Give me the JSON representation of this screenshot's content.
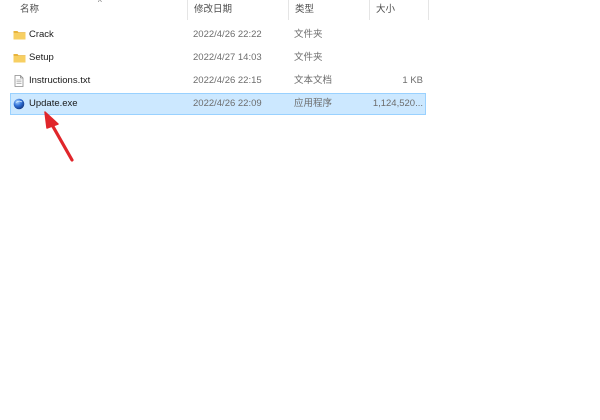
{
  "columns": {
    "name": "名称",
    "date": "修改日期",
    "type": "类型",
    "size": "大小",
    "sort_indicator": "^"
  },
  "files": [
    {
      "name": "Crack",
      "date": "2022/4/26 22:22",
      "type": "文件夹",
      "size": "",
      "icon": "folder-icon",
      "selected": false
    },
    {
      "name": "Setup",
      "date": "2022/4/27 14:03",
      "type": "文件夹",
      "size": "",
      "icon": "folder-icon",
      "selected": false
    },
    {
      "name": "Instructions.txt",
      "date": "2022/4/26 22:15",
      "type": "文本文档",
      "size": "1 KB",
      "icon": "text-file-icon",
      "selected": false
    },
    {
      "name": "Update.exe",
      "date": "2022/4/26 22:09",
      "type": "应用程序",
      "size": "1,124,520...",
      "icon": "exe-icon",
      "selected": true
    }
  ],
  "colors": {
    "selection_bg": "#cce8ff",
    "selection_border": "#99d1ff",
    "folder": "#f2c55c",
    "annotation_arrow": "#e0262b"
  }
}
